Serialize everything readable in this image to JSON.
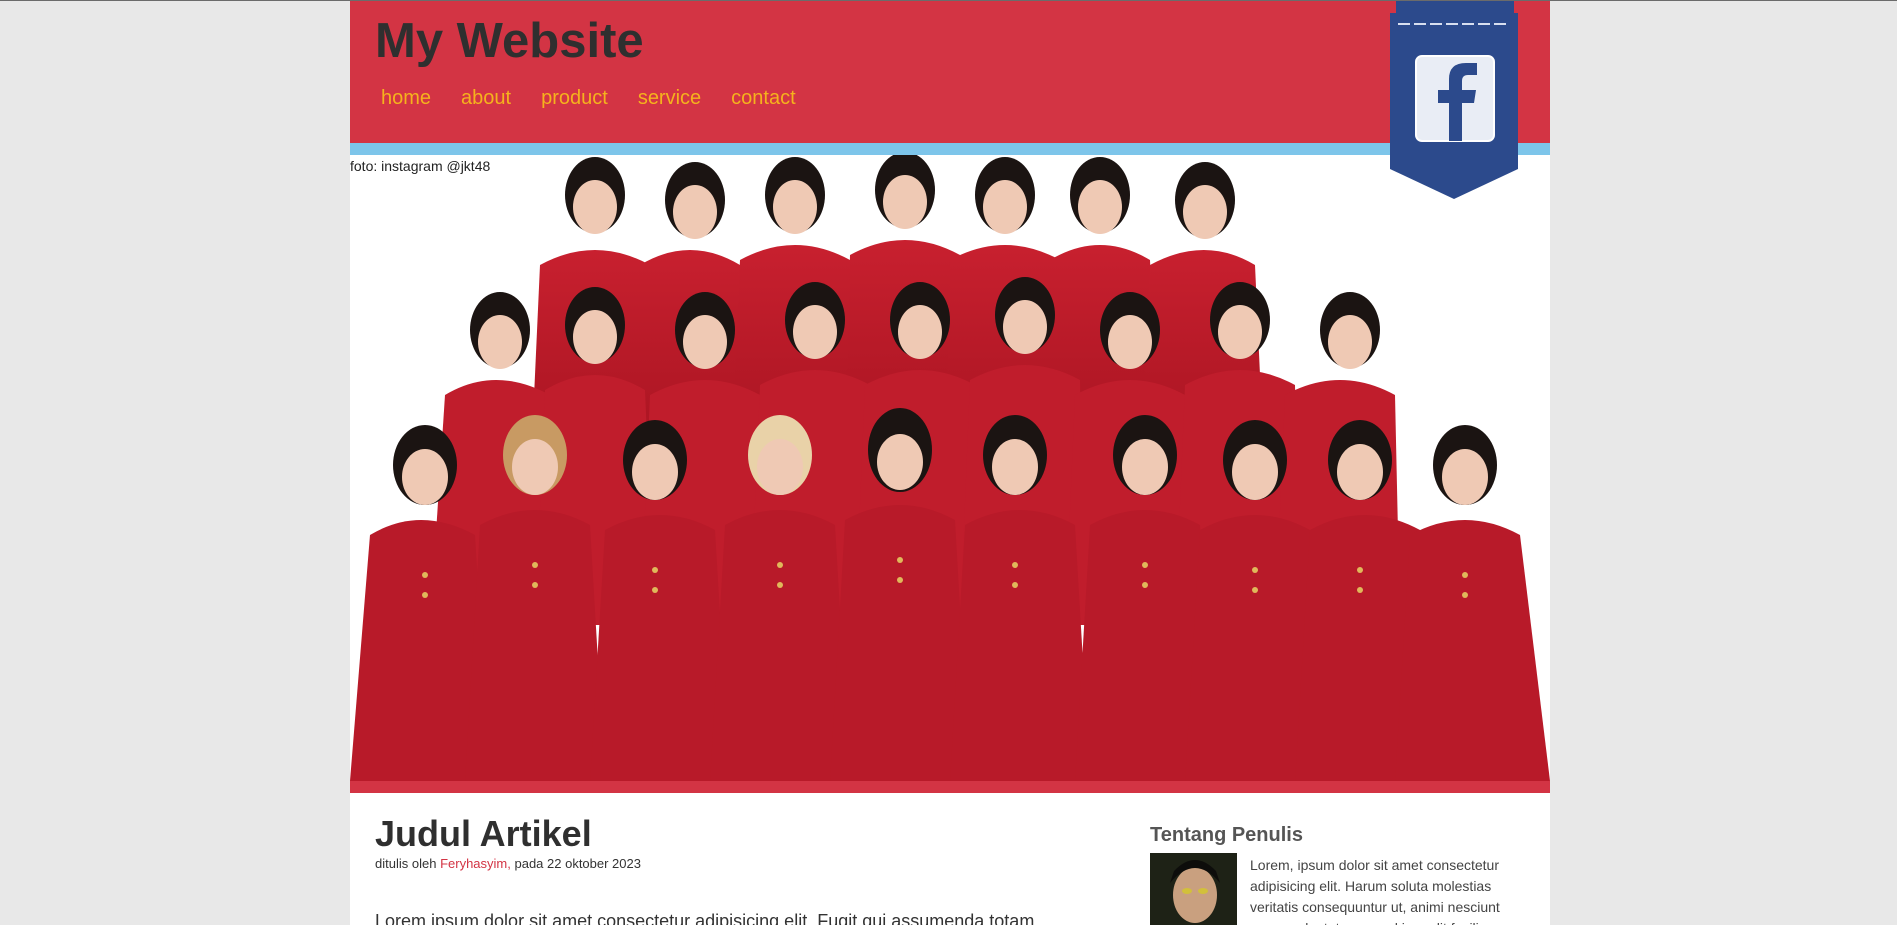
{
  "header": {
    "site_title": "My Website",
    "nav": [
      "home",
      "about",
      "product",
      "service",
      "contact"
    ]
  },
  "hero": {
    "caption": "foto: instagram @jkt48"
  },
  "social": {
    "icon": "facebook-icon"
  },
  "article": {
    "title": "Judul Artikel",
    "meta_prefix": "ditulis oleh",
    "author": "Feryhasyim,",
    "meta_suffix": "pada 22 oktober 2023",
    "body_first_line": "Lorem ipsum dolor sit amet consectetur adipisicing elit. Fugit qui assumenda totam"
  },
  "sidebar": {
    "title": "Tentang Penulis",
    "text": "Lorem, ipsum dolor sit amet consectetur adipisicing elit. Harum soluta molestias veritatis consequuntur ut, animi nesciunt rerum voluptatem, quod impedit facilis"
  },
  "colors": {
    "header_red": "#d33444",
    "nav_yellow": "#f5b21d",
    "strip_blue": "#7dc5ea",
    "badge_blue": "#2c4a8c"
  }
}
